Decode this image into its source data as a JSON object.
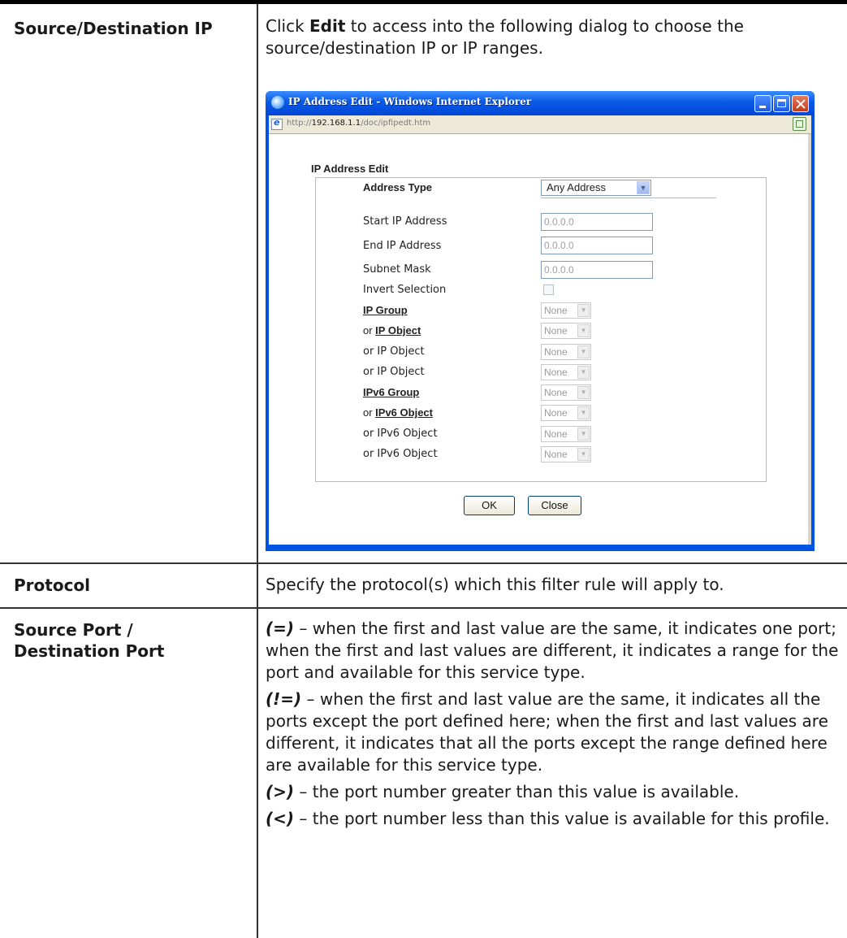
{
  "rows": [
    {
      "label": "Source/Destination IP",
      "desc_before": "Click ",
      "desc_bold": "Edit",
      "desc_after": " to access into the following dialog to choose the source/destination IP or IP ranges."
    },
    {
      "label": "Protocol",
      "desc": "Specify the protocol(s) which this filter rule will apply to."
    },
    {
      "label_line1": "Source Port /",
      "label_line2": "Destination Port",
      "items": [
        {
          "symbol": "(=)",
          "text": " – when the first and last value are the same, it indicates one port; when the first and last values are different, it indicates a range for the port and available for this service type."
        },
        {
          "symbol": "(!=)",
          "text": " – when the first and last value are the same, it indicates all the ports except the port defined here; when the first and last values are different, it indicates that all the ports except the range defined here are available for this service type."
        },
        {
          "symbol": "(>)",
          "text": " – the port number greater than this value is available."
        },
        {
          "symbol": "(<)",
          "text": " – the port number less than this value is available for this profile."
        }
      ]
    }
  ],
  "browser": {
    "title": "IP Address Edit - Windows Internet Explorer",
    "url_prefix": "http://",
    "url_host": "192.168.1.1",
    "url_path": "/doc/ipfipedt.htm"
  },
  "dialog": {
    "heading": "IP Address Edit",
    "address_type_label": "Address Type",
    "address_type_value": "Any Address",
    "start_ip_label": "Start IP Address",
    "start_ip_value": "0.0.0.0",
    "end_ip_label": "End IP Address",
    "end_ip_value": "0.0.0.0",
    "subnet_label": "Subnet Mask",
    "subnet_value": "0.0.0.0",
    "invert_label": "Invert Selection",
    "or_prefix": "or ",
    "ip_group_label": "IP Group",
    "ip_object_link": "IP Object",
    "ip_object_label": "or IP Object",
    "ipv6_group_label": "IPv6 Group",
    "ipv6_object_link": "IPv6 Object",
    "ipv6_object_label": "or IPv6 Object",
    "none_option": "None",
    "ok_label": "OK",
    "close_label": "Close"
  }
}
